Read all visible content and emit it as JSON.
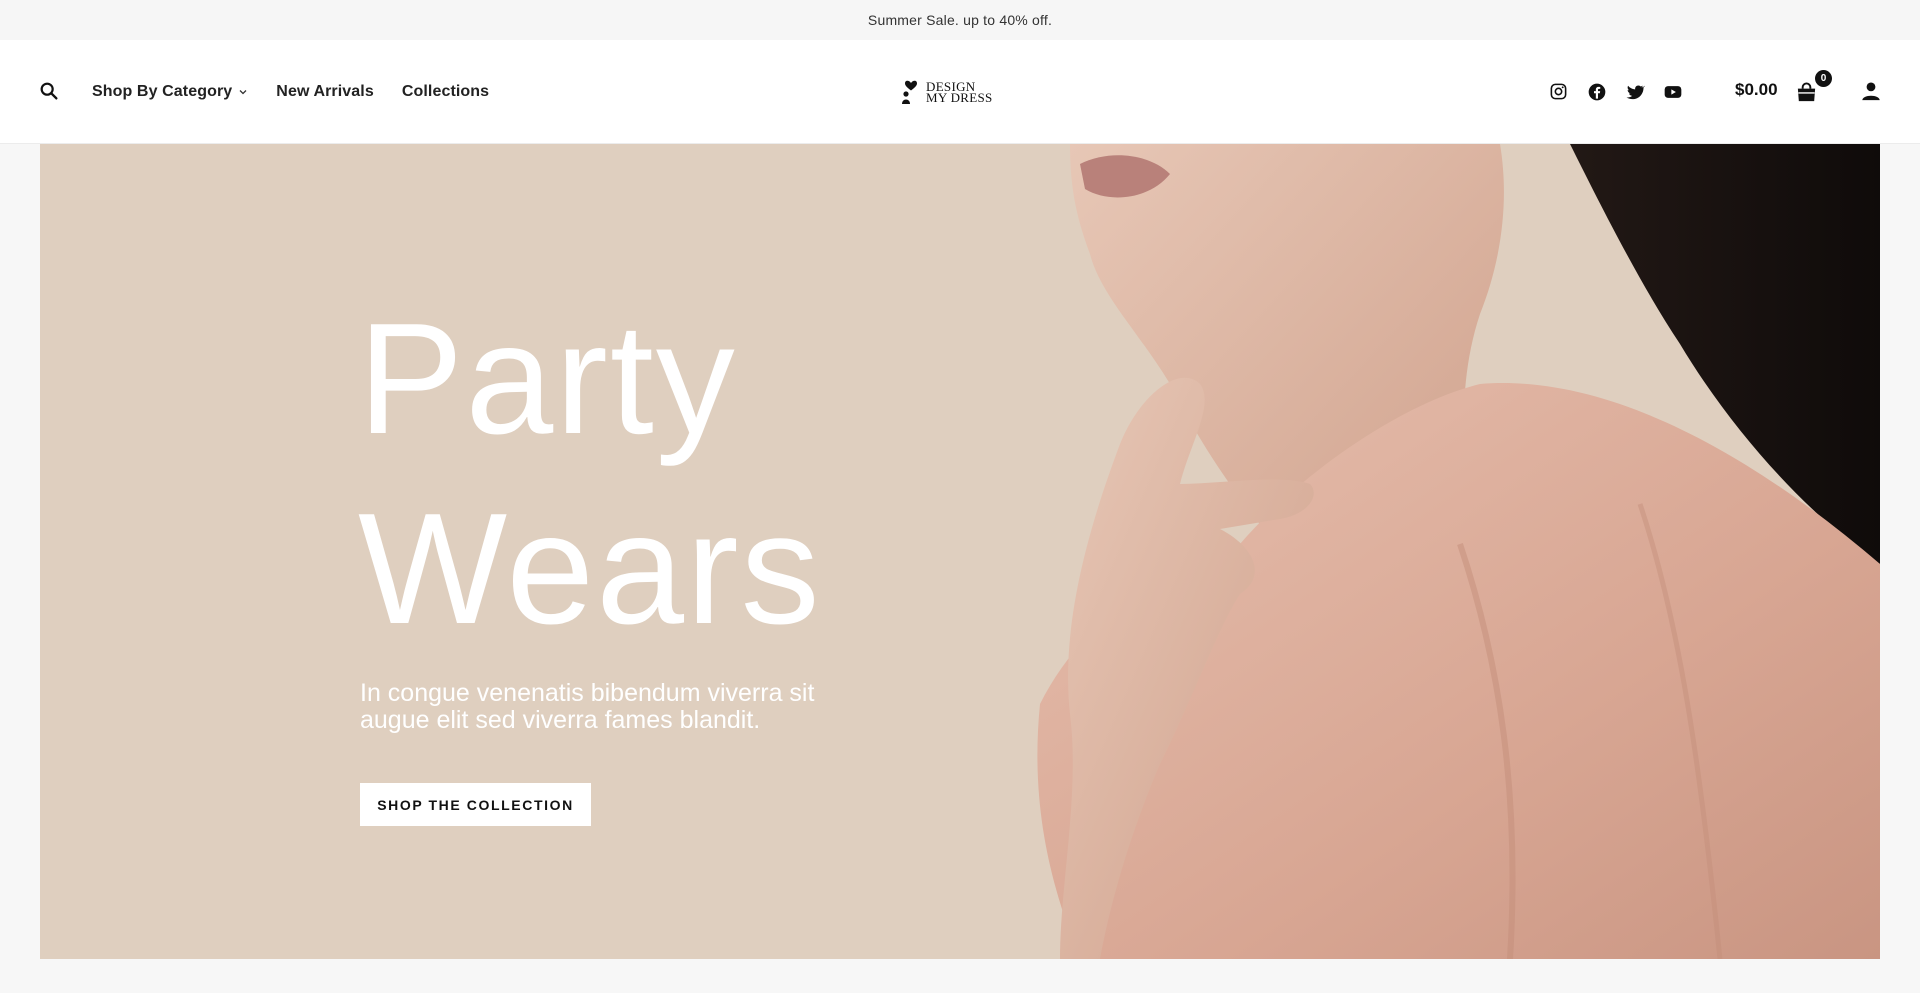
{
  "announcement": "Summer Sale. up to 40% off.",
  "nav": {
    "items": [
      {
        "label": "Shop By Category",
        "has_dropdown": true
      },
      {
        "label": "New Arrivals"
      },
      {
        "label": "Collections"
      }
    ]
  },
  "logo": {
    "line1": "DESIGN",
    "line2": "MY DRESS"
  },
  "social": [
    "instagram-icon",
    "facebook-icon",
    "twitter-icon",
    "youtube-icon"
  ],
  "cart": {
    "amount": "$0.00",
    "count": "0"
  },
  "hero": {
    "headline_line1": "Party",
    "headline_line2": "Wears",
    "subtitle": "In congue venenatis bibendum viverra sit augue elit sed viverra fames blandit.",
    "cta_label": "SHOP THE COLLECTION",
    "background_color": "#dfcfbf"
  },
  "colors": {
    "accent": "#111111",
    "hero_text": "#ffffff"
  }
}
